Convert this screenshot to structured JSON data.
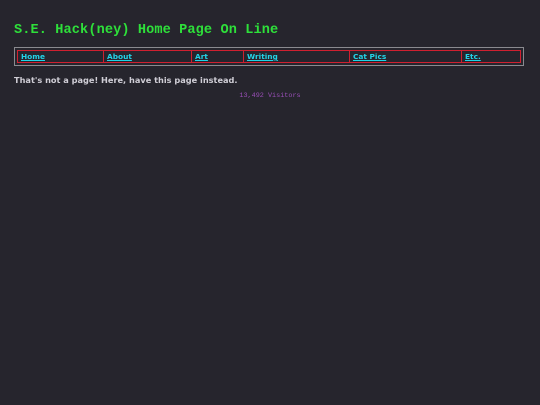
{
  "site": {
    "title": "S.E. Hack(ney) Home Page On Line"
  },
  "nav": {
    "items": [
      {
        "label": "Home"
      },
      {
        "label": "About"
      },
      {
        "label": "Art"
      },
      {
        "label": "Writing"
      },
      {
        "label": "Cat Pics"
      },
      {
        "label": "Etc."
      }
    ]
  },
  "main": {
    "message": "That's not a page! Here, have this page instead."
  },
  "footer": {
    "visitor_count": "13,492",
    "visitor_label": "Visitors"
  },
  "colors": {
    "background": "#26252d",
    "title": "#2ee03a",
    "link": "#22d4e8",
    "nav_border": "#d02030",
    "visitors": "#9a4fb8"
  }
}
